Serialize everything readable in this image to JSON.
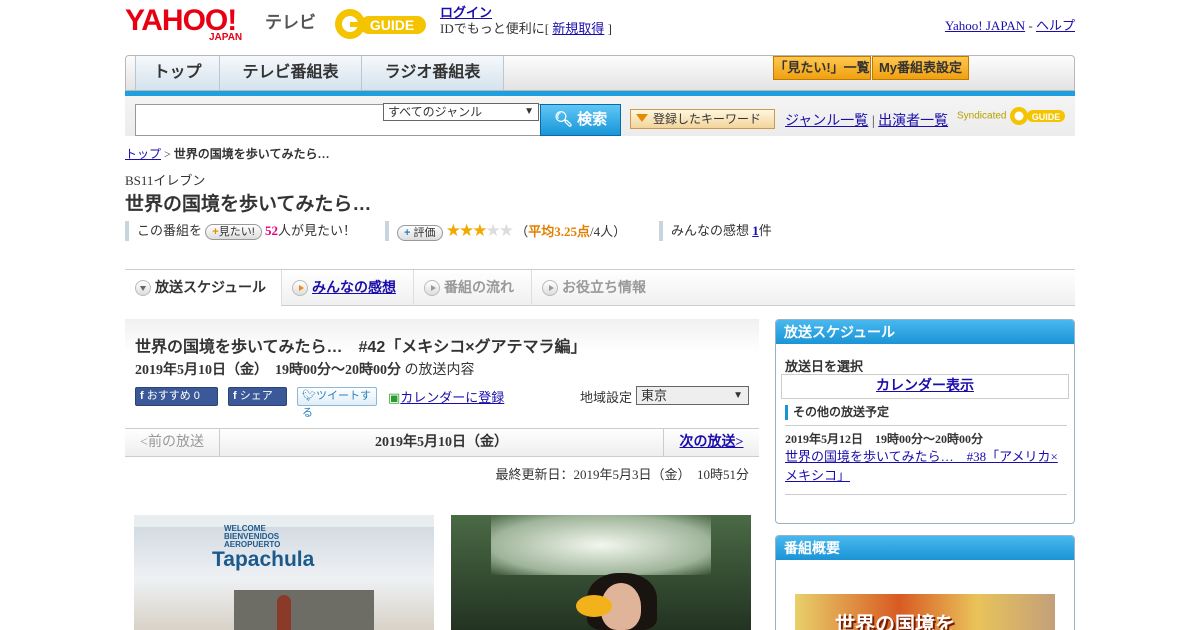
{
  "header": {
    "yahoo_logo_text": "YAHOO!",
    "yahoo_logo_sub": "JAPAN",
    "site_name": "テレビ",
    "gguide_logo": "G GUIDE",
    "login": "ログイン",
    "login_note_prefix": "IDでもっと便利に[",
    "signup": "新規取得",
    "login_note_suffix": "]",
    "yahoo_japan_link": "Yahoo! JAPAN",
    "separator": "-",
    "help_link": "ヘルプ"
  },
  "nav": {
    "tabs": [
      "トップ",
      "テレビ番組表",
      "ラジオ番組表"
    ],
    "want_list": "「見たい!」一覧",
    "my_schedule": "My番組表設定"
  },
  "search": {
    "genre_selected": "すべてのジャンル",
    "search_button": "検索",
    "keyword_button": "登録したキーワード",
    "genre_list_link": "ジャンル一覧",
    "link_separator": "|",
    "performer_list_link": "出演者一覧",
    "syndicated": "Syndicated"
  },
  "breadcrumb": {
    "home": "トップ",
    "separator": ">",
    "current": "世界の国境を歩いてみたら…"
  },
  "program": {
    "channel": "BS11イレブン",
    "title": "世界の国境を歩いてみたら…",
    "want_prefix": "この番組を",
    "want_button": "見たい!",
    "want_count": "52",
    "want_suffix": "人が見たい！",
    "rate_button": "評価",
    "rating_value": 3.25,
    "rating_text_prefix": "（",
    "rating_avg": "平均3.25点",
    "rating_text_suffix": "/4人）",
    "impressions_prefix": "みんなの感想",
    "impressions_count": "1",
    "impressions_suffix": "件"
  },
  "tabs": [
    {
      "label": "放送スケジュール",
      "state": "active"
    },
    {
      "label": "みんなの感想",
      "state": "link"
    },
    {
      "label": "番組の流れ",
      "state": "disabled"
    },
    {
      "label": "お役立ち情報",
      "state": "disabled"
    }
  ],
  "episode": {
    "title": "世界の国境を歩いてみたら…　#42「メキシコ×グアテマラ編」",
    "datetime": "2019年5月10日（金）　19時00分～20時00分",
    "datetime_suffix": "の放送内容",
    "recommend_button": "おすすめ 0",
    "share_button": "シェア",
    "tweet_button": "ツイートする",
    "calendar_link": "カレンダーに登録",
    "region_label": "地域設定",
    "region_selected": "東京"
  },
  "date_nav": {
    "prev": "<前の放送",
    "current": "2019年5月10日（金）",
    "next": "次の放送>"
  },
  "updated": "最終更新日：2019年5月3日（金）　10時51分",
  "photos": {
    "photo1_sign_small": "WELCOME BIENVENIDOS AEROPUERTO",
    "photo1_sign": "Tapachula"
  },
  "sidebar": {
    "schedule_title": "放送スケジュール",
    "select_date": "放送日を選択",
    "calendar_button": "カレンダー表示",
    "other_title": "その他の放送予定",
    "other_datetime": "2019年5月12日　19時00分～20時00分",
    "other_link": "世界の国境を歩いてみたら…　#38「アメリカ×メキシコ」",
    "summary_title": "番組概要",
    "summary_image_text": "世界の国境を"
  },
  "colors": {
    "accent_blue": "#1d9fe0",
    "yahoo_red": "#e60012",
    "star": "#f2a900",
    "pink": "#e4007f"
  }
}
